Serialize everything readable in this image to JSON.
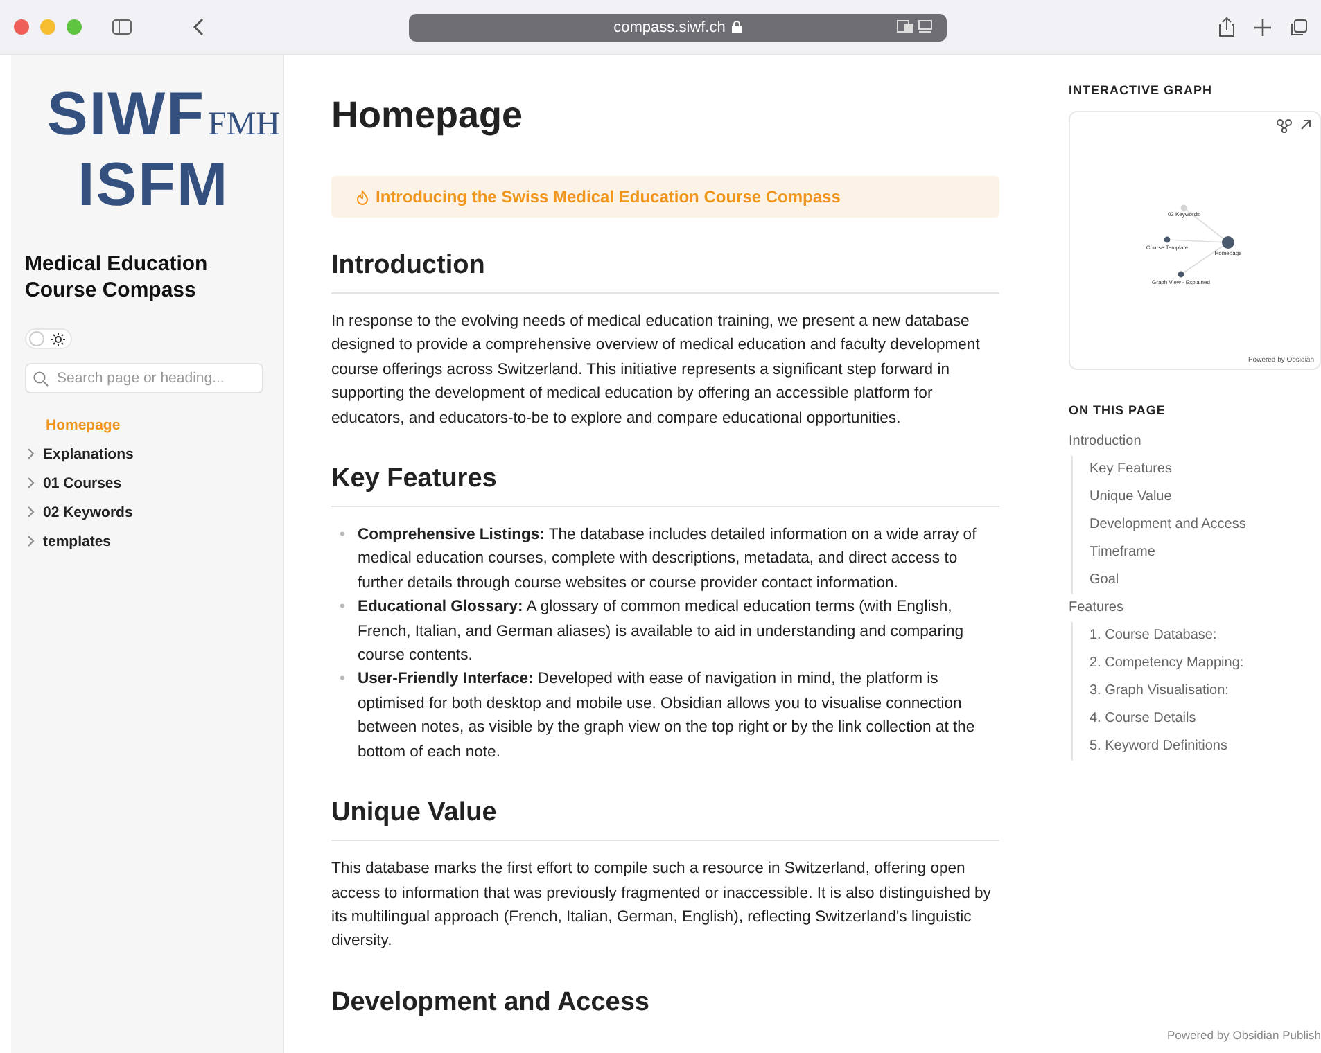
{
  "browser": {
    "url": "compass.siwf.ch"
  },
  "sidebar": {
    "logo": {
      "line_1": "SIWF",
      "suffix": "FMH",
      "line_2": "ISFM"
    },
    "site_title": "Medical Education Course Compass",
    "theme_toggle": {
      "on": false
    },
    "search": {
      "placeholder": "Search page or heading..."
    },
    "items": [
      {
        "label": "Homepage",
        "selected": true,
        "kind": "page"
      },
      {
        "label": "Explanations",
        "selected": false,
        "kind": "folder",
        "expanded": false
      },
      {
        "label": "01 Courses",
        "selected": false,
        "kind": "folder",
        "expanded": false
      },
      {
        "label": "02 Keywords",
        "selected": false,
        "kind": "folder",
        "expanded": false
      },
      {
        "label": "templates",
        "selected": false,
        "kind": "folder",
        "expanded": false
      }
    ]
  },
  "article": {
    "title": "Homepage",
    "callout": "Introducing the Swiss Medical Education Course Compass",
    "sections": [
      {
        "heading": "Introduction",
        "kind": "paragraph",
        "text": "In response to the evolving needs of medical education training, we present a new database designed to provide a comprehensive overview of medical education and faculty development course offerings across Switzerland. This initiative represents a significant step forward in supporting the development of medical education by offering an accessible platform for educators, and educators-to-be to explore and compare educational opportunities."
      },
      {
        "heading": "Key Features",
        "kind": "list",
        "items": [
          {
            "marker": "•",
            "text": "**Comprehensive Listings:** The database includes detailed information on a wide array of medical education courses, complete with descriptions, metadata, and direct access to further details through course websites or course provider contact information."
          },
          {
            "marker": "•",
            "text": "**Educational Glossary:** A glossary of common medical education terms (with English, French, Italian, and German aliases) is available to aid in understanding and comparing course contents."
          },
          {
            "marker": "•",
            "text": "**User-Friendly Interface:** Developed with ease of navigation in mind, the platform is optimised for both desktop and mobile use. Obsidian allows you to visualise connection between notes, as visible by the graph view on the top right or by the link collection at the bottom of each note."
          }
        ]
      },
      {
        "heading": "Unique Value",
        "kind": "paragraph",
        "text": "This database marks the first effort to compile such a resource in Switzerland, offering open access to information that was previously fragmented or inaccessible. It is also distinguished by its multilingual approach (French, Italian, German, English), reflecting Switzerland's linguistic diversity."
      },
      {
        "heading": "Development and Access",
        "kind": "heading_only"
      }
    ]
  },
  "graph": {
    "title": "INTERACTIVE GRAPH",
    "nodes": [
      {
        "label": "02 Keywords",
        "color": "#d4d4d4"
      },
      {
        "label": "Course Template",
        "color": "#4a5a6c"
      },
      {
        "label": "Homepage",
        "color": "#4a5a6c"
      },
      {
        "label": "Graph View - Explained",
        "color": "#4a5a6c"
      }
    ],
    "credit": "Powered by Obsidian"
  },
  "toc": {
    "title": "ON THIS PAGE",
    "items": [
      {
        "label": "Introduction",
        "children": [
          {
            "label": "Key Features"
          },
          {
            "label": "Unique Value"
          },
          {
            "label": "Development and Access"
          },
          {
            "label": "Timeframe"
          },
          {
            "label": "Goal"
          }
        ]
      },
      {
        "label": "Features",
        "children": [
          {
            "label": "1. Course Database:"
          },
          {
            "label": "2. Competency Mapping:"
          },
          {
            "label": "3. Graph Visualisation:"
          },
          {
            "label": "4. Course Details"
          },
          {
            "label": "5. Keyword Definitions"
          }
        ]
      }
    ]
  },
  "footer": "Powered by Obsidian Publish"
}
